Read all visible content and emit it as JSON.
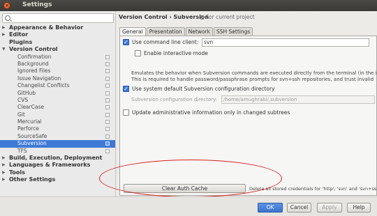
{
  "window": {
    "title": "Settings",
    "close_glyph": "×"
  },
  "search": {
    "placeholder": ""
  },
  "sidebar": {
    "items": [
      {
        "label": "Appearance & Behavior",
        "level": "top",
        "arrow": "▶"
      },
      {
        "label": "Editor",
        "level": "top",
        "arrow": "▶"
      },
      {
        "label": "Plugins",
        "level": "top",
        "arrow": ""
      },
      {
        "label": "Version Control",
        "level": "top",
        "arrow": "▼"
      },
      {
        "label": "Confirmation",
        "level": "sub"
      },
      {
        "label": "Background",
        "level": "sub"
      },
      {
        "label": "Ignored Files",
        "level": "sub"
      },
      {
        "label": "Issue Navigation",
        "level": "sub"
      },
      {
        "label": "Changelist Conflicts",
        "level": "sub"
      },
      {
        "label": "GitHub",
        "level": "sub"
      },
      {
        "label": "CVS",
        "level": "sub"
      },
      {
        "label": "ClearCase",
        "level": "sub"
      },
      {
        "label": "Git",
        "level": "sub"
      },
      {
        "label": "Mercurial",
        "level": "sub"
      },
      {
        "label": "Perforce",
        "level": "sub"
      },
      {
        "label": "SourceSafe",
        "level": "sub"
      },
      {
        "label": "Subversion",
        "level": "sub",
        "selected": true
      },
      {
        "label": "TFS",
        "level": "sub"
      },
      {
        "label": "Build, Execution, Deployment",
        "level": "top",
        "arrow": "▶"
      },
      {
        "label": "Languages & Frameworks",
        "level": "top",
        "arrow": "▶"
      },
      {
        "label": "Tools",
        "level": "top",
        "arrow": "▶"
      },
      {
        "label": "Other Settings",
        "level": "top",
        "arrow": "▶"
      }
    ]
  },
  "content": {
    "breadcrumb": "Version Control › Subversion",
    "for_current_project": "For current project",
    "tabs": [
      {
        "label": "General",
        "active": true
      },
      {
        "label": "Presentation"
      },
      {
        "label": "Network"
      },
      {
        "label": "SSH Settings"
      }
    ],
    "use_command_line": {
      "label": "Use command line client:",
      "checked": true,
      "value": "svn"
    },
    "enable_interactive": {
      "label": "Enable interactive mode",
      "checked": false
    },
    "emulate_line1": "Emulates the behavior when Subversion commands are executed directly from the terminal (in the in",
    "emulate_line2": "This is required to handle password/passphrase prompts for svn+ssh repositories, and trust invalid",
    "use_system_default": {
      "label": "Use system default Subversion configuration directory",
      "checked": true
    },
    "config_dir_label": "Subversion configuration directory:",
    "config_dir_value": "/home/amughrabi/.subversion",
    "update_admin": {
      "label": "Update administrative information only in changed subtrees",
      "checked": false
    },
    "clear_cache_label": "Clear Auth Cache",
    "clear_cache_desc": "Delete all stored credentials for 'http', 'svn' and 'svn+ss"
  },
  "footer": {
    "ok": "OK",
    "cancel": "Cancel",
    "apply": "Apply",
    "help": "Help"
  },
  "colors": {
    "accent": "#3f79d6",
    "annotation": "#d81e1e",
    "titlebar": "#3c3b37"
  }
}
